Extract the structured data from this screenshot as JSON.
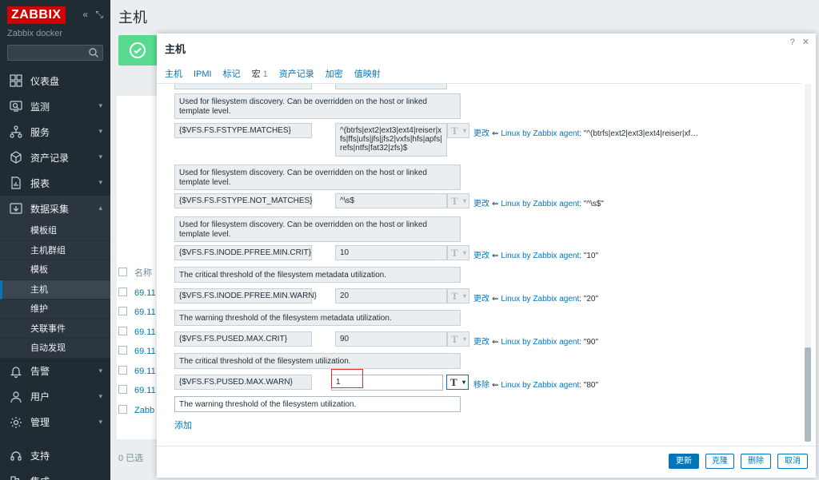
{
  "sidebar": {
    "logo": "ZABBIX",
    "subtitle": "Zabbix docker",
    "menu": [
      {
        "label": "仪表盘",
        "icon": "dashboard-icon"
      },
      {
        "label": "监测",
        "icon": "monitoring-icon"
      },
      {
        "label": "服务",
        "icon": "services-icon"
      },
      {
        "label": "资产记录",
        "icon": "inventory-icon"
      },
      {
        "label": "报表",
        "icon": "reports-icon"
      },
      {
        "label": "数据采集",
        "icon": "data-collection-icon"
      }
    ],
    "submenu": [
      "模板组",
      "主机群组",
      "模板",
      "主机",
      "维护",
      "关联事件",
      "自动发现"
    ],
    "menu_bottom": [
      {
        "label": "告警",
        "icon": "bell-icon"
      },
      {
        "label": "用户",
        "icon": "users-icon"
      },
      {
        "label": "管理",
        "icon": "gear-icon"
      },
      {
        "label": "支持",
        "icon": "headset-icon"
      },
      {
        "label": "集成",
        "icon": "integrations-icon"
      }
    ]
  },
  "main": {
    "title": "主机",
    "col_name": "名称",
    "rows": [
      "69.11",
      "69.11",
      "69.11",
      "69.11",
      "69.11",
      "69.11",
      "Zabb"
    ],
    "selected": "0 已选"
  },
  "modal": {
    "title": "主机",
    "help": "?",
    "close": "✕",
    "tabs": [
      "主机",
      "IPMI",
      "标记",
      "宏",
      "资产记录",
      "加密",
      "值映射"
    ],
    "tab_macro_count": "1",
    "macros": [
      {
        "desc": "Used for filesystem discovery. Can be overridden on the host or linked template level."
      },
      {
        "macro": "{$VFS.FS.FSTYPE.MATCHES}",
        "value": "^(btrfs|ext2|ext3|ext4|reiser|xfs|ffs|ufs|jfs|jfs2|vxfs|hfs|apfs|refs|ntfs|fat32|zfs)$",
        "action": "更改",
        "source": "Linux by Zabbix agent",
        "inherited": ": \"^(btrfs|ext2|ext3|ext4|reiser|xf…",
        "desc": "Used for filesystem discovery. Can be overridden on the host or linked template level."
      },
      {
        "macro": "{$VFS.FS.FSTYPE.NOT_MATCHES}",
        "value": "^\\s$",
        "action": "更改",
        "source": "Linux by Zabbix agent",
        "inherited": ": \"^\\s$\"",
        "desc": "Used for filesystem discovery. Can be overridden on the host or linked template level."
      },
      {
        "macro": "{$VFS.FS.INODE.PFREE.MIN.CRIT}",
        "value": "10",
        "action": "更改",
        "source": "Linux by Zabbix agent",
        "inherited": ": \"10\"",
        "desc": "The critical threshold of the filesystem metadata utilization."
      },
      {
        "macro": "{$VFS.FS.INODE.PFREE.MIN.WARN}",
        "value": "20",
        "action": "更改",
        "source": "Linux by Zabbix agent",
        "inherited": ": \"20\"",
        "desc": "The warning threshold of the filesystem metadata utilization."
      },
      {
        "macro": "{$VFS.FS.PUSED.MAX.CRIT}",
        "value": "90",
        "action": "更改",
        "source": "Linux by Zabbix agent",
        "inherited": ": \"90\"",
        "desc": "The critical threshold of the filesystem utilization."
      },
      {
        "macro": "{$VFS.FS.PUSED.MAX.WARN}",
        "value": "1",
        "action": "移除",
        "source": "Linux by Zabbix agent",
        "inherited": ": \"80\"",
        "desc": "The warning threshold of the filesystem utilization."
      }
    ],
    "type_glyph": "T",
    "dropdown_glyph": "▾",
    "add": "添加",
    "buttons": {
      "update": "更新",
      "clone": "克隆",
      "delete": "删除",
      "cancel": "取消"
    }
  },
  "colors": {
    "accent": "#0275b8",
    "sidebar": "#1f2c33",
    "logo": "#d40000",
    "success": "#59db8f",
    "highlight": "#e03030"
  }
}
